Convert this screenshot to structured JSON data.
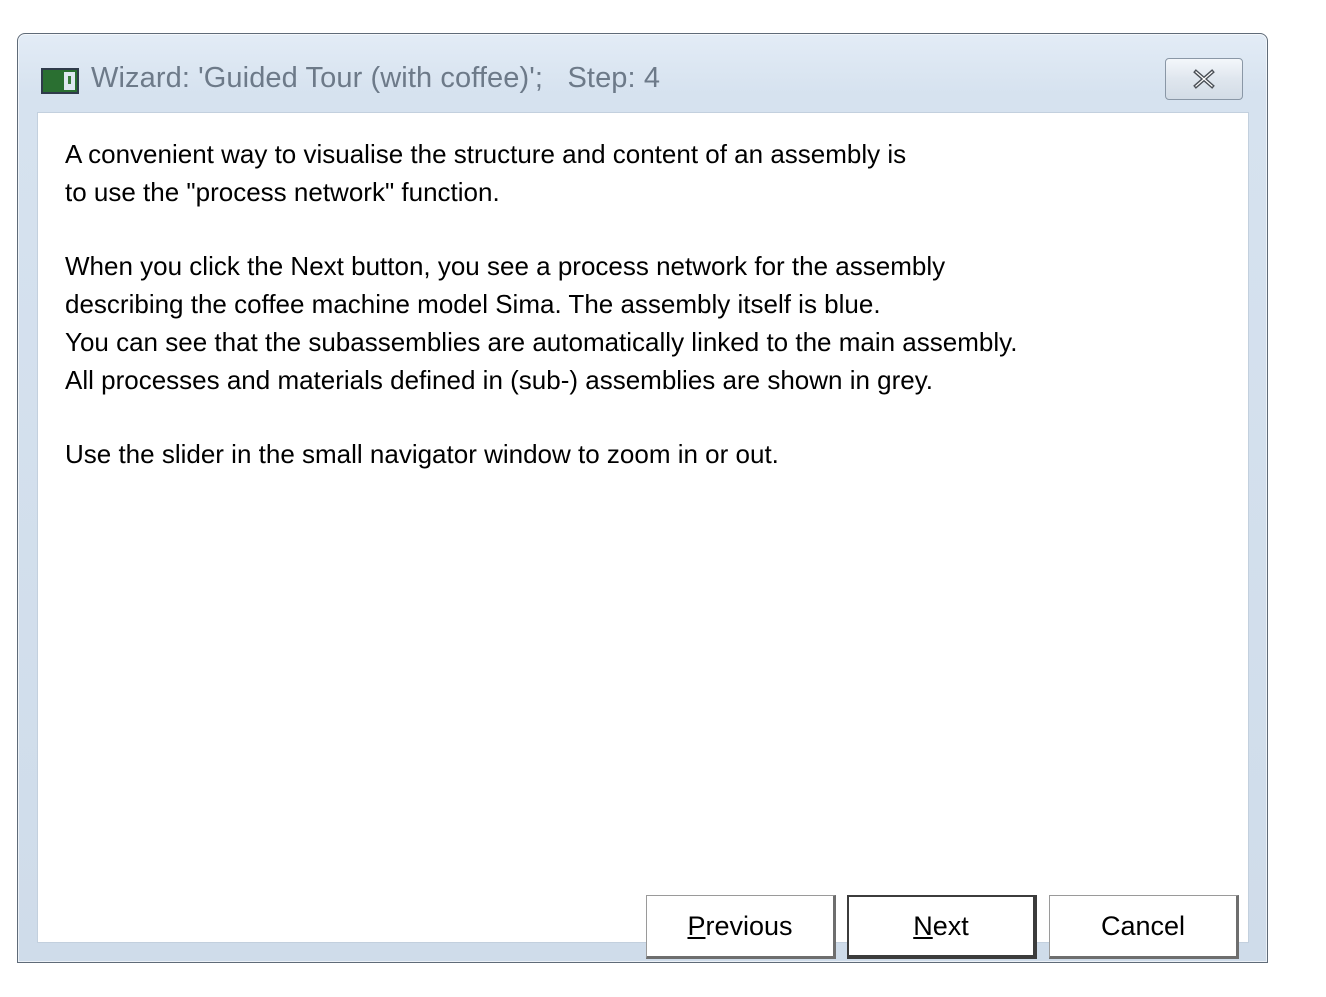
{
  "window": {
    "title": "Wizard: 'Guided Tour (with coffee)';   Step: 4",
    "icon": "app-window-icon",
    "close_icon": "close-x-icon"
  },
  "content": {
    "paragraphs": [
      "A convenient way to visualise the structure and content of an assembly is\nto use the \"process network\" function.",
      "When you click the Next button, you see a process network for the assembly\ndescribing the coffee machine model Sima. The assembly itself is blue.\nYou can see that  the subassemblies are automatically linked to the main assembly.\nAll processes and materials defined in (sub-) assemblies are shown in grey.",
      "Use the slider in the small navigator window to zoom in or out."
    ]
  },
  "buttons": {
    "previous": {
      "mnemonic": "P",
      "rest": "revious"
    },
    "next": {
      "mnemonic": "N",
      "rest": "ext"
    },
    "cancel": {
      "label": "Cancel"
    }
  }
}
